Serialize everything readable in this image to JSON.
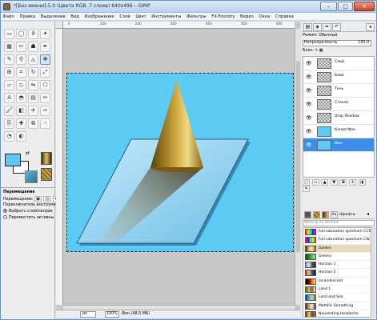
{
  "window": {
    "title": "*[Без имени]-5.0 (Цвета RGB, 7 слоев) 640x496 – GIMP",
    "minimize": "–",
    "maximize": "□",
    "close": "×"
  },
  "menu": [
    "Файл",
    "Правка",
    "Выделение",
    "Вид",
    "Изображение",
    "Цвет",
    "Слой",
    "Цвет",
    "Инструменты",
    "Фильтры",
    "FX-Foundry",
    "Видео",
    "Окна",
    "Справка"
  ],
  "toolbox": {
    "tools": [
      {
        "icon": "rect-select-icon",
        "glyph": "▭"
      },
      {
        "icon": "ellipse-select-icon",
        "glyph": "◯"
      },
      {
        "icon": "free-select-icon",
        "glyph": "ϑ"
      },
      {
        "icon": "fuzzy-select-icon",
        "glyph": "✦"
      },
      {
        "icon": "color-select-icon",
        "glyph": "▦"
      },
      {
        "icon": "scissors-icon",
        "glyph": "✂"
      },
      {
        "icon": "foreground-select-icon",
        "glyph": "☗"
      },
      {
        "icon": "paths-icon",
        "glyph": "✒"
      },
      {
        "icon": "color-picker-icon",
        "glyph": "✎"
      },
      {
        "icon": "zoom-icon",
        "glyph": "⚲"
      },
      {
        "icon": "measure-icon",
        "glyph": "◬"
      },
      {
        "icon": "move-icon",
        "glyph": "✥"
      },
      {
        "icon": "align-icon",
        "glyph": "⊞"
      },
      {
        "icon": "crop-icon",
        "glyph": "⌗"
      },
      {
        "icon": "rotate-icon",
        "glyph": "↻"
      },
      {
        "icon": "scale-icon",
        "glyph": "⤢"
      },
      {
        "icon": "shear-icon",
        "glyph": "▱"
      },
      {
        "icon": "perspective-icon",
        "glyph": "⏢"
      },
      {
        "icon": "flip-icon",
        "glyph": "⇋"
      },
      {
        "icon": "cage-icon",
        "glyph": "⬠"
      },
      {
        "icon": "text-icon",
        "glyph": "A"
      },
      {
        "icon": "bucket-fill-icon",
        "glyph": "◓"
      },
      {
        "icon": "blend-icon",
        "glyph": "▤"
      },
      {
        "icon": "pencil-icon",
        "glyph": "✏"
      },
      {
        "icon": "paintbrush-icon",
        "glyph": "🖌"
      },
      {
        "icon": "eraser-icon",
        "glyph": "◧"
      },
      {
        "icon": "airbrush-icon",
        "glyph": "✈"
      },
      {
        "icon": "ink-icon",
        "glyph": "✑"
      },
      {
        "icon": "clone-icon",
        "glyph": "⎘"
      },
      {
        "icon": "heal-icon",
        "glyph": "✚"
      },
      {
        "icon": "perspective-clone-icon",
        "glyph": "⧉"
      },
      {
        "icon": "smudge-icon",
        "glyph": "☝"
      },
      {
        "icon": "convolve-icon",
        "glyph": "◔"
      },
      {
        "icon": "dodge-burn-icon",
        "glyph": "◐"
      }
    ],
    "options": {
      "title": "Перемещение",
      "move_label": "Перемещение:",
      "switch_label": "Переключатель инструмента",
      "radio1": "Выбрать слой/направ",
      "radio2": "Переместить активны"
    },
    "colors": {
      "fg": "#5cc7f0",
      "bg": "#ffffff"
    }
  },
  "canvas": {
    "ruler_labels": [
      "0",
      "100",
      "200",
      "300",
      "400",
      "500",
      "600"
    ],
    "status": {
      "unit": "px",
      "zoom": "100%",
      "info": "Фон (48,5 МБ)"
    }
  },
  "layers": {
    "mode_label": "Режим: Обычный",
    "opacity_label": "Непрозрачность",
    "opacity_value": "100,0",
    "lock_label": "Блок:",
    "items": [
      {
        "name": "Слой",
        "thumb": "checker"
      },
      {
        "name": "Блик",
        "thumb": "checker"
      },
      {
        "name": "Тень",
        "thumb": "checker"
      },
      {
        "name": "Стекло",
        "thumb": "checker"
      },
      {
        "name": "Drop Shadow",
        "thumb": "checker"
      },
      {
        "name": "Копия Фон",
        "thumb": "#5ccbf4"
      },
      {
        "name": "Фон",
        "thumb": "#5ccbf4"
      }
    ],
    "selected": 6
  },
  "gradients": {
    "filter_placeholder": "Фильтр по меткам",
    "items": [
      {
        "name": "Full saturation spectrum CCW",
        "css": "linear-gradient(90deg,red,orange,yellow,lime,cyan,blue,magenta,red)"
      },
      {
        "name": "Full saturation spectrum CW",
        "css": "linear-gradient(90deg,red,magenta,blue,cyan,lime,yellow,orange,red)"
      },
      {
        "name": "Golden",
        "css": "linear-gradient(90deg,#3b2a05,#e8c45a,#f8e9a8,#8b6a1c)"
      },
      {
        "name": "Greens",
        "css": "linear-gradient(90deg,#0c3d10,#3ba53b,#a9e07a)"
      },
      {
        "name": "Horizon 1",
        "css": "linear-gradient(90deg,#4aa0e8,#e8e8ff,#5d5436,#2b2a1a)"
      },
      {
        "name": "Horizon 2",
        "css": "linear-gradient(90deg,#c23a20,#f2c860,#3c4ea8,#101040)"
      },
      {
        "name": "Incandescent",
        "css": "linear-gradient(90deg,#000,#7a0000,#ff6a00,#ffff90)"
      },
      {
        "name": "Land 1",
        "css": "linear-gradient(90deg,#2a7a2a,#c8b46a,#8b5a2a,#fff)"
      },
      {
        "name": "Land and Sea",
        "css": "linear-gradient(90deg,#103c8c,#49a5e0,#e8d08c,#3b8a3a)"
      },
      {
        "name": "Metallic Something",
        "css": "linear-gradient(90deg,#2a2a80,#e0a030,#f8f0d0,#30308a)"
      },
      {
        "name": "Nauseating Headache",
        "css": "linear-gradient(90deg,#4a3a10,#f0e020,#8b2a6a,#40a040)"
      }
    ],
    "selected": 2
  }
}
